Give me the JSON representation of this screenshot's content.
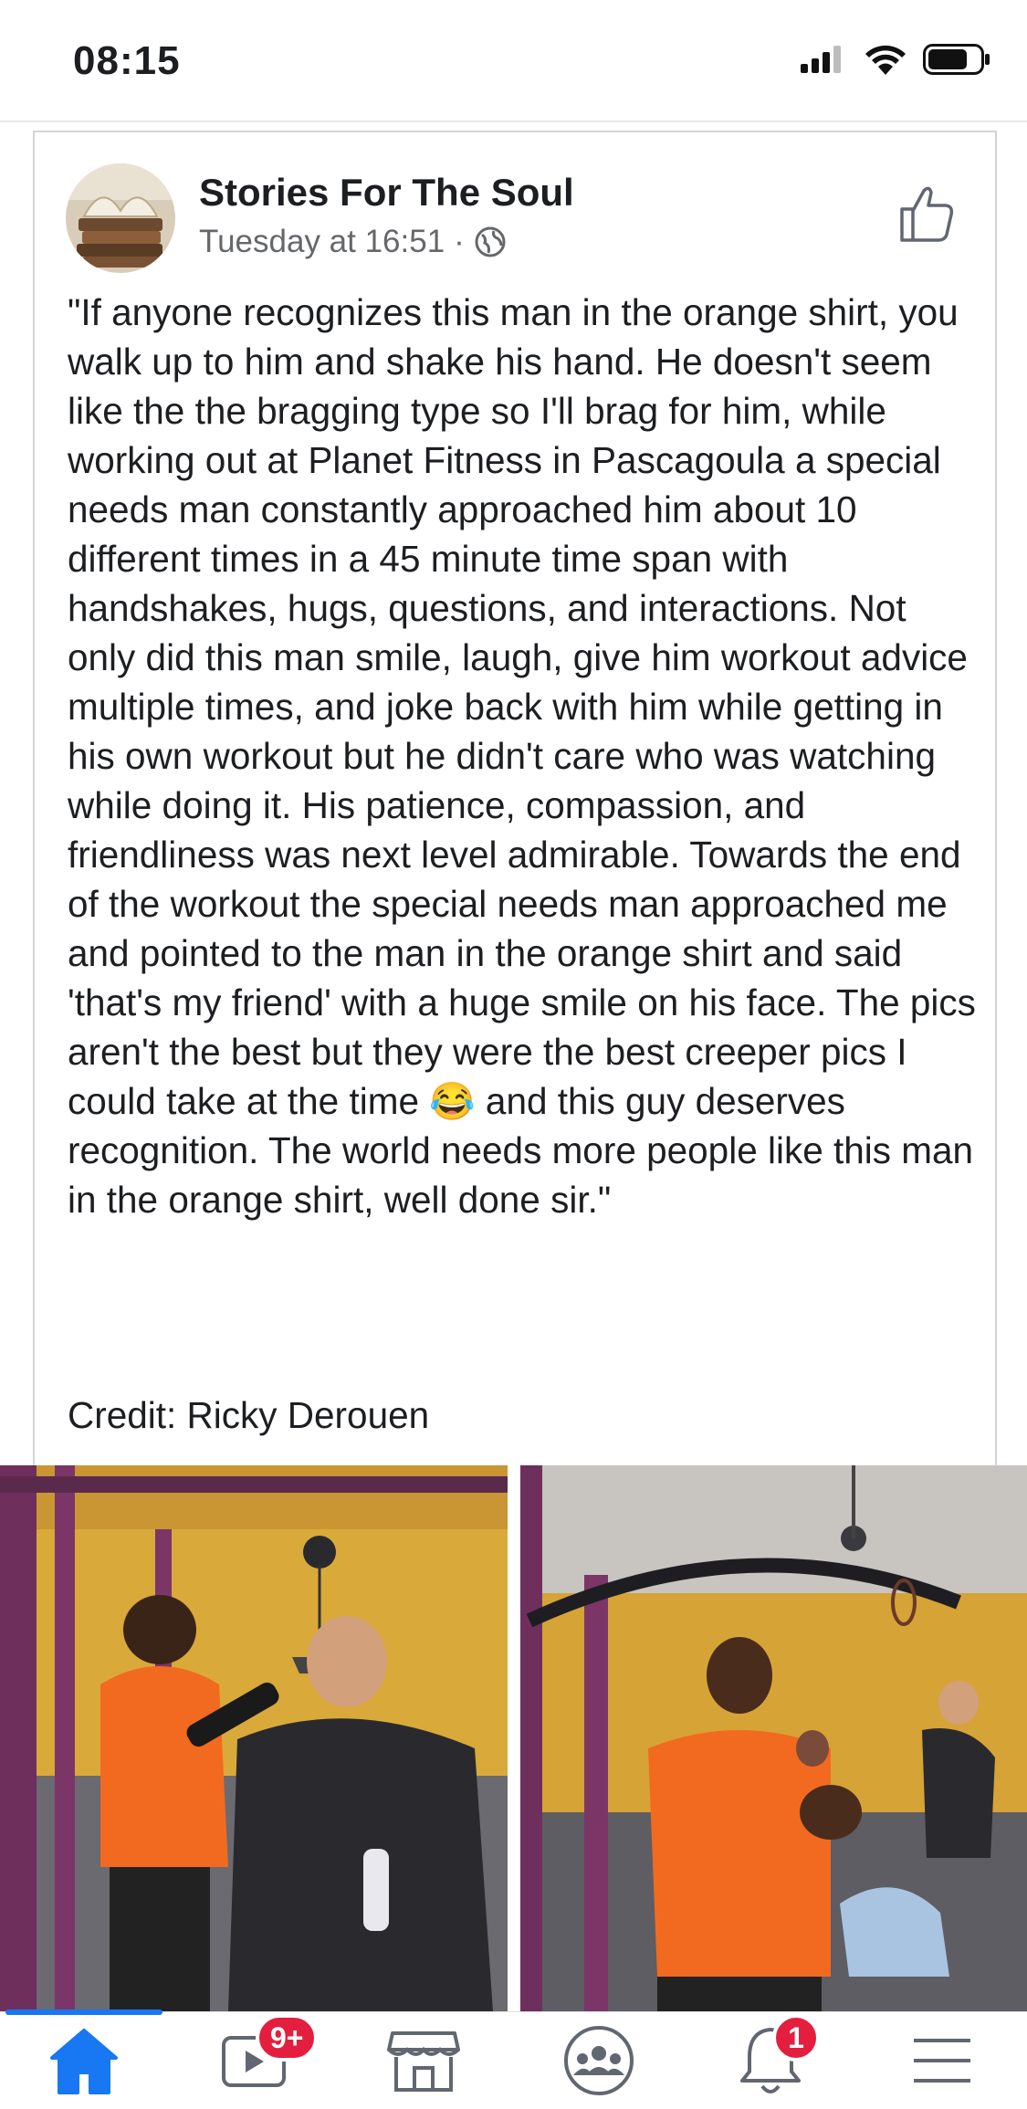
{
  "status_bar": {
    "time": "08:15",
    "icons": [
      "cellular-signal-icon",
      "wifi-icon",
      "battery-icon"
    ]
  },
  "post": {
    "page_name": "Stories For The Soul",
    "timestamp": "Tuesday at 16:51",
    "separator": "·",
    "audience_icon": "globe-icon",
    "like_icon": "thumbs-up-icon",
    "body_before_emoji": "\"If anyone recognizes this man in the orange shirt, you walk up to him and shake his hand. He doesn't seem like the the bragging type so I'll brag for him, while working out at Planet Fitness in Pascagoula a special needs man constantly approached him about 10 different times in a 45 minute time span with handshakes, hugs, questions, and interactions. Not only did this man smile, laugh, give him workout advice multiple times, and joke back with him while getting in his own workout but he didn't care who was watching while doing it. His patience, compassion, and friendliness was next level admirable. Towards the end of the workout the special needs man approached me and pointed to the man in the orange shirt and said 'that's my friend' with a huge smile on his face. The pics aren't the best but they were the best creeper pics I could take at the time ",
    "emoji": "😂",
    "body_after_emoji": " and this guy deserves recognition. The world needs more people like this man in the orange shirt, well done sir.\"",
    "credit": "Credit: Ricky Derouen"
  },
  "tab_bar": {
    "tabs": [
      {
        "name": "home",
        "icon": "home-icon",
        "active": true
      },
      {
        "name": "watch",
        "icon": "video-icon",
        "badge": "9+"
      },
      {
        "name": "marketplace",
        "icon": "marketplace-icon"
      },
      {
        "name": "groups",
        "icon": "groups-icon"
      },
      {
        "name": "notifications",
        "icon": "bell-icon",
        "badge": "1"
      },
      {
        "name": "menu",
        "icon": "hamburger-menu-icon"
      }
    ]
  },
  "colors": {
    "accent": "#1877f2",
    "badge": "#e41e3f",
    "secondary_text": "#65676b"
  }
}
